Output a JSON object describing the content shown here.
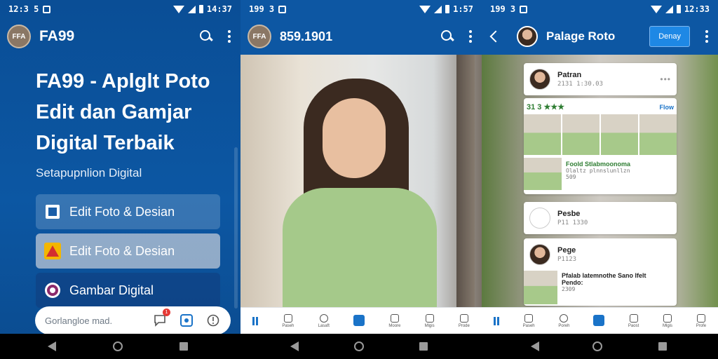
{
  "screen1": {
    "status": {
      "time": "12:3 5",
      "clock": "14:37"
    },
    "logo": "FFA",
    "title": "FA99",
    "hero": "FA99 - Aplglt Poto Edit dan Gamjar Digital Terbaik",
    "subtitle": "Setapupnlion Digital",
    "menu": [
      {
        "label": "Edit Foto & Desian",
        "icon": "photo-frame-icon"
      },
      {
        "label": "Edit Foto & Desian",
        "icon": "warning-triangle-icon"
      },
      {
        "label": "Gambar Digital",
        "icon": "gallery-circle-icon"
      }
    ],
    "input_placeholder": "Gorlangloe mad.",
    "badge": "1"
  },
  "screen2": {
    "status": {
      "time": "199 3",
      "clock": "1:57"
    },
    "logo": "FFA",
    "title": "859.1901",
    "nav": [
      "",
      "Paseh",
      "Lasaft",
      "",
      "Moore",
      "Mlgis",
      "Prode"
    ]
  },
  "screen3": {
    "status": {
      "time": "199 3",
      "clock": "12:33"
    },
    "title": "Palage Roto",
    "follow": "Denay",
    "cards": [
      {
        "name": "Patran",
        "meta": "2131 1:30.03"
      },
      {
        "stars_text": "31 3 ★★★",
        "follow": "Flow",
        "caption": "Foold Stlabmoonoma",
        "caption2": "Olaltz plnnslunllzn",
        "count": "509"
      },
      {
        "name": "Pesbe",
        "meta": "P11 1330"
      },
      {
        "name": "Pege",
        "meta": "P1123",
        "caption": "Pfalab latemnothe Sano Ifelt",
        "caption2": "Pendo:",
        "count": "2309"
      }
    ],
    "nav": [
      "",
      "Paseh",
      "Poreh",
      "",
      "Paost",
      "Mlgis",
      "Profe"
    ]
  },
  "colors": {
    "primary": "#0d57a3",
    "accent": "#1a73c8"
  }
}
